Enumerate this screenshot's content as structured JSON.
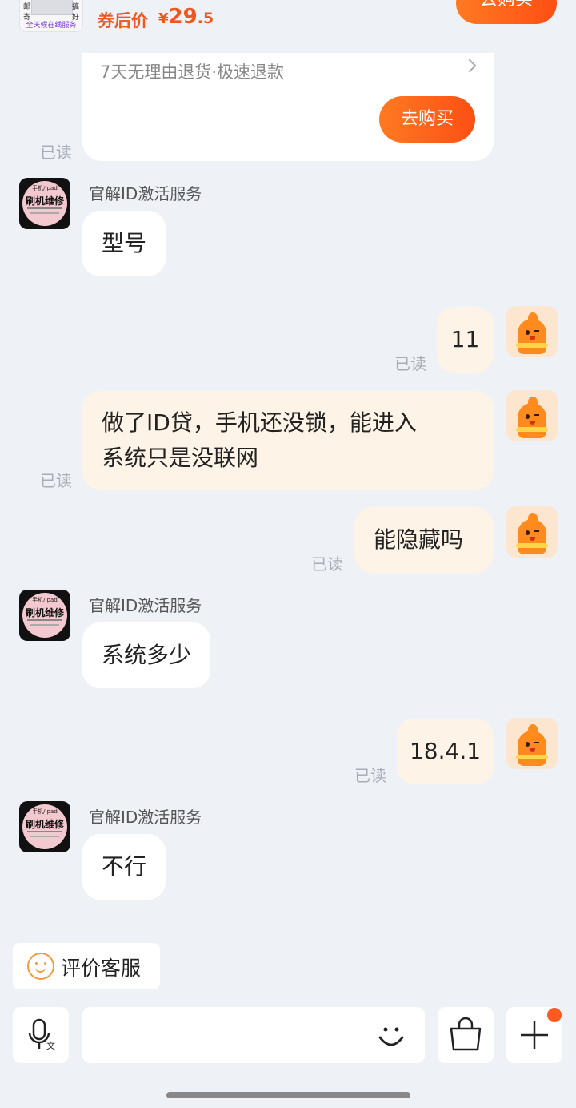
{
  "product": {
    "thumb_side_left": "邮\n寄",
    "thumb_side_right": "搞\n好",
    "thumb_caption": "全天候在线服务",
    "price_label": "券后价",
    "price_currency": "¥",
    "price_int": "29",
    "price_dec": ".5",
    "top_buy_label": "去购买",
    "card_text": "7天无理由退货·极速退款",
    "card_buy_label": "去购买"
  },
  "read_label": "已读",
  "avatar_shop": {
    "line1": "手机/Ipad",
    "line2": "刷机维修"
  },
  "messages": [
    {
      "side": "in",
      "sender": "官解ID激活服务",
      "text": "型号"
    },
    {
      "side": "out",
      "text": "11"
    },
    {
      "side": "out",
      "text_line1": "做了ID贷，手机还没锁，能进入",
      "text_line2": "系统只是没联网"
    },
    {
      "side": "out",
      "text": "能隐藏吗"
    },
    {
      "side": "in",
      "sender": "官解ID激活服务",
      "text": "系统多少"
    },
    {
      "side": "out",
      "text": "18.4.1"
    },
    {
      "side": "in",
      "sender": "官解ID激活服务",
      "text": "不行"
    }
  ],
  "bottom": {
    "rate_label": "评价客服"
  },
  "colors": {
    "accent": "#fd4f14",
    "bubble_out": "#fdf3e6",
    "background": "#eef2f7"
  }
}
